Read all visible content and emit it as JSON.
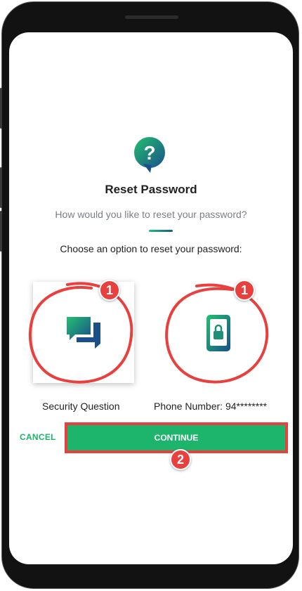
{
  "dialog": {
    "title": "Reset Password",
    "subtitle": "How would you like to reset your password?",
    "instruction": "Choose an option to reset your password:"
  },
  "options": [
    {
      "label": "Security Question",
      "icon": "chat-bubbles-icon"
    },
    {
      "label": "Phone Number: 94********",
      "icon": "mobile-phone-lock-icon"
    }
  ],
  "actions": {
    "cancel_label": "CANCEL",
    "continue_label": "CONTINUE"
  },
  "annotations": {
    "step1": "1",
    "step2": "2"
  },
  "colors": {
    "accent_green": "#1db46b",
    "accent_blue": "#1a5a8a",
    "annotation_red": "#e8403f"
  }
}
